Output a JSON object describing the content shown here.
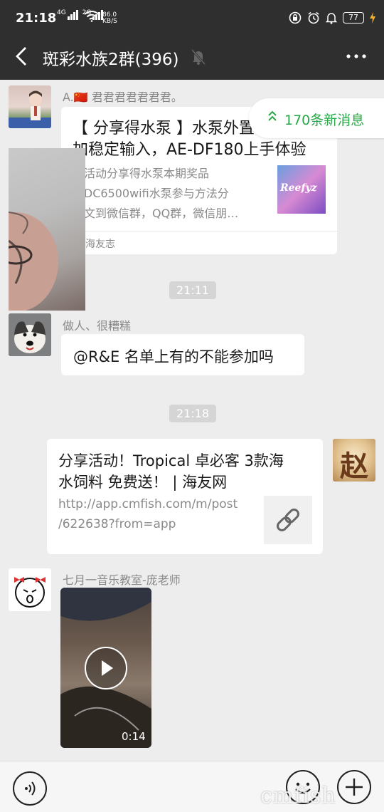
{
  "status": {
    "time": "21:18",
    "net1": "4G",
    "net2": "2G",
    "speed_value": "86.0",
    "speed_unit": "KB/S",
    "battery": "77"
  },
  "header": {
    "title": "斑彩水族2群(396)"
  },
  "new_messages": {
    "label": "170条新消息"
  },
  "messages": {
    "m1": {
      "sender": "A.🇨🇳 君君君君君君君。",
      "title": "【 分享得水泵 】水泵外置，稳定输入，AE-DF180上手体验",
      "title_line1": "【 分享得水泵 】水泵外置",
      "title_line2": "加稳定输入，AE-DF180上手体验",
      "desc1": "期活动分享得水泵本期奖品",
      "desc2": "E-DC6500wifi水泵参与方法分",
      "desc3": "本文到微信群，QQ群，微信朋…",
      "thumb_text": "Reefyz",
      "source": "海友志"
    },
    "t1": "21:11",
    "m2": {
      "sender": "做人、很糟糕",
      "text": "@R&E 名单上有的不能参加吗"
    },
    "t2": "21:18",
    "m3": {
      "title_line1": "分享活动！Tropical 卓必客 3款海",
      "title_line2": "水饲料 免费送！ | 海友网",
      "link_line1": "http://app.cmfish.com/m/post",
      "link_line2": "/622638?from=app",
      "avatar_char": "赵"
    },
    "m4": {
      "sender": "七月一音乐教室-庞老师",
      "duration": "0:14"
    }
  },
  "watermark": "cmfish",
  "colors": {
    "header_bg": "#2f2f2f",
    "chat_bg": "#ededed",
    "accent_green": "#2aa748"
  }
}
